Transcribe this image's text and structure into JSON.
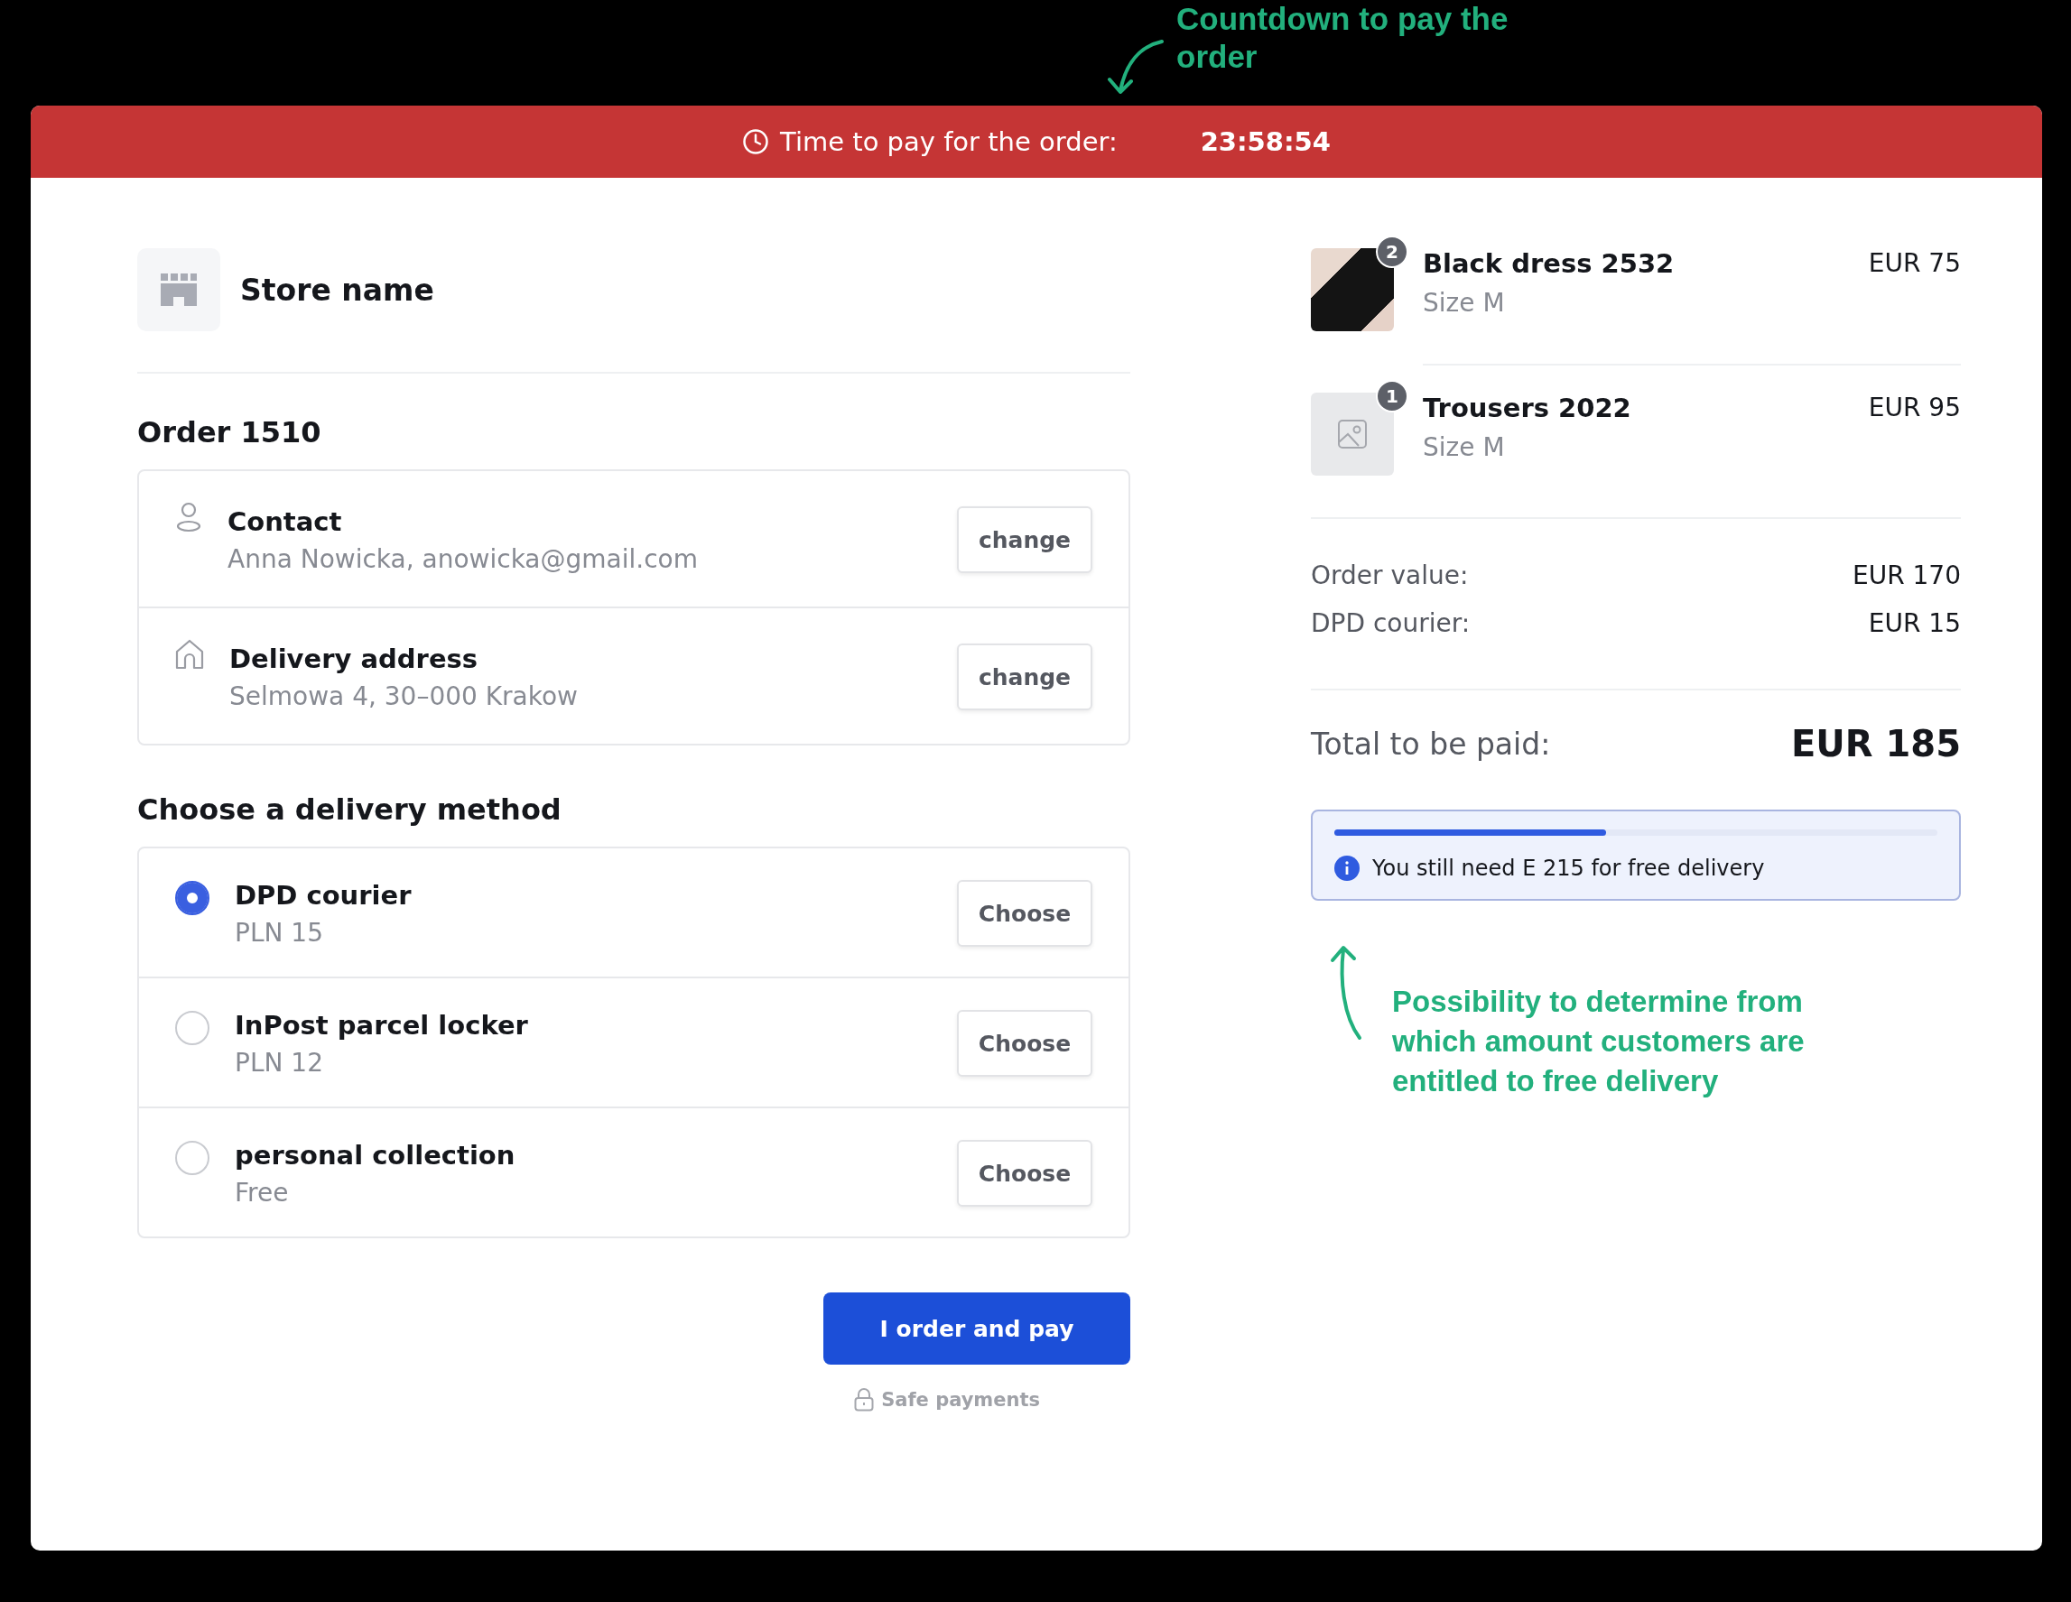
{
  "annotations": [
    {
      "kind": "down",
      "text": "Countdown to pay the order"
    },
    {
      "kind": "up",
      "text": "Possibility to determine from which amount customers are entitled to free delivery"
    }
  ],
  "timer_bar": {
    "label": "Time to pay for the order:",
    "time": "23:58:54"
  },
  "store": {
    "name": "Store name"
  },
  "order": {
    "title": "Order 1510",
    "details": [
      {
        "kind": "contact",
        "title": "Contact",
        "value": "Anna Nowicka, anowicka@gmail.com",
        "button": "change"
      },
      {
        "kind": "address",
        "title": "Delivery address",
        "value": "Selmowa 4, 30–000 Krakow",
        "button": "change"
      }
    ]
  },
  "delivery": {
    "title": "Choose a delivery method",
    "options": [
      {
        "name": "DPD courier",
        "price": "PLN 15",
        "selected": true,
        "button": "Choose"
      },
      {
        "name": "InPost parcel locker",
        "price": "PLN 12",
        "selected": false,
        "button": "Choose"
      },
      {
        "name": "personal collection",
        "price": "Free",
        "selected": false,
        "button": "Choose"
      }
    ]
  },
  "submit": {
    "label": "I order and pay",
    "note": "Safe payments"
  },
  "cart": {
    "items": [
      {
        "kind": "photo",
        "count": "2",
        "name": "Black dress 2532",
        "variant": "Size M",
        "price": "EUR 75"
      },
      {
        "kind": "placeholder",
        "count": "1",
        "name": "Trousers 2022",
        "variant": "Size M",
        "price": "EUR 95"
      }
    ],
    "lines": [
      {
        "label": "Order value:",
        "value": "EUR 170"
      },
      {
        "label": "DPD courier:",
        "value": "EUR 15"
      }
    ],
    "total": {
      "label": "Total to be paid:",
      "value": "EUR 185"
    },
    "free_delivery": {
      "level": 0.45,
      "message": "You still need E 215 for free delivery"
    }
  }
}
